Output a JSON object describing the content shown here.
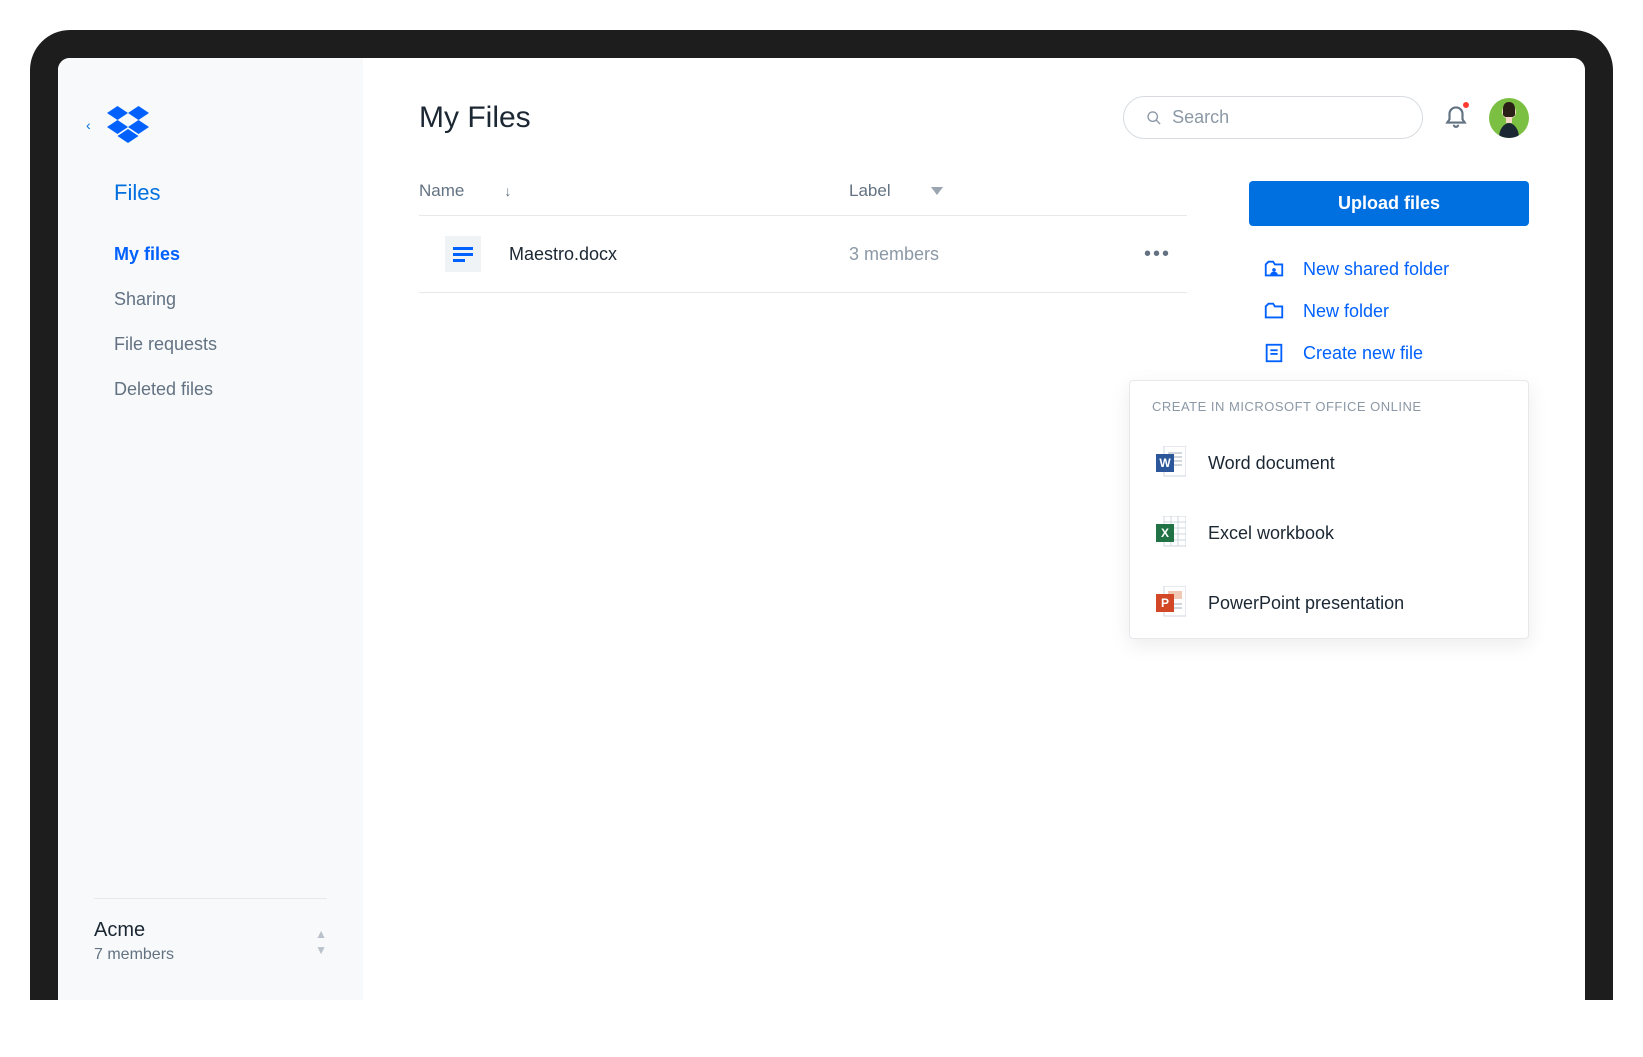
{
  "sidebar": {
    "section_title": "Files",
    "nav": [
      {
        "label": "My files",
        "active": true
      },
      {
        "label": "Sharing",
        "active": false
      },
      {
        "label": "File requests",
        "active": false
      },
      {
        "label": "Deleted files",
        "active": false
      }
    ],
    "team": {
      "name": "Acme",
      "members": "7 members"
    }
  },
  "header": {
    "page_title": "My Files",
    "search_placeholder": "Search"
  },
  "table": {
    "columns": {
      "name": "Name",
      "label": "Label"
    },
    "rows": [
      {
        "name": "Maestro.docx",
        "label": "3 members"
      }
    ]
  },
  "actions": {
    "upload": "Upload files",
    "links": [
      "New shared folder",
      "New folder",
      "Create new file"
    ]
  },
  "office_popup": {
    "header": "CREATE IN MICROSOFT OFFICE ONLINE",
    "items": [
      "Word document",
      "Excel workbook",
      "PowerPoint presentation"
    ]
  },
  "colors": {
    "brand_blue": "#0061ff",
    "action_blue": "#0070e0",
    "text_primary": "#1b2733",
    "text_muted": "#637282",
    "avatar_bg": "#7bc043"
  }
}
